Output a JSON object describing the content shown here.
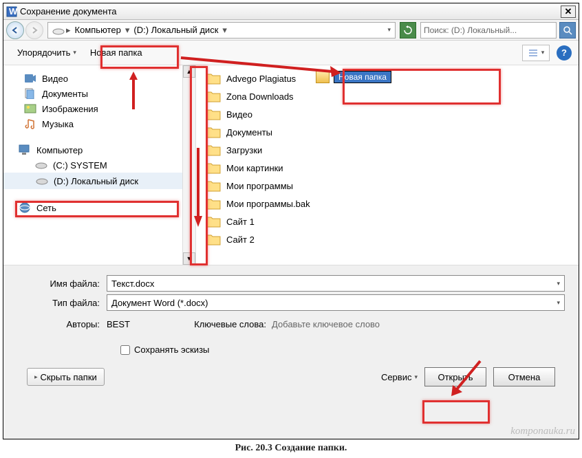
{
  "window": {
    "title": "Сохранение документа"
  },
  "nav": {
    "crumb_computer": "Компьютер",
    "crumb_drive": "(D:) Локальный диск",
    "search_placeholder": "Поиск: (D:) Локальный..."
  },
  "toolbar": {
    "organize": "Упорядочить",
    "new_folder": "Новая папка"
  },
  "sidebar": {
    "libs": [
      "Видео",
      "Документы",
      "Изображения",
      "Музыка"
    ],
    "computer": "Компьютер",
    "drives": [
      "(C:) SYSTEM",
      "(D:) Локальный диск"
    ],
    "network": "Сеть"
  },
  "folders": [
    "Advego Plagiatus",
    "Zona Downloads",
    "Видео",
    "Документы",
    "Загрузки",
    "Мои картинки",
    "Мои программы",
    "Мои программы.bak",
    "Сайт 1",
    "Сайт 2"
  ],
  "new_folder_name": "Новая папка",
  "form": {
    "filename_label": "Имя файла:",
    "filename_value": "Текст.docx",
    "filetype_label": "Тип файла:",
    "filetype_value": "Документ Word (*.docx)",
    "authors_label": "Авторы:",
    "authors_value": "BEST",
    "keywords_label": "Ключевые слова:",
    "keywords_value": "Добавьте ключевое слово",
    "save_thumbs": "Сохранять эскизы"
  },
  "buttons": {
    "hide_folders": "Скрыть папки",
    "service": "Сервис",
    "open": "Открыть",
    "cancel": "Отмена"
  },
  "help": "?",
  "caption": "Рис. 20.3 Создание папки.",
  "watermark": "komponauka.ru"
}
